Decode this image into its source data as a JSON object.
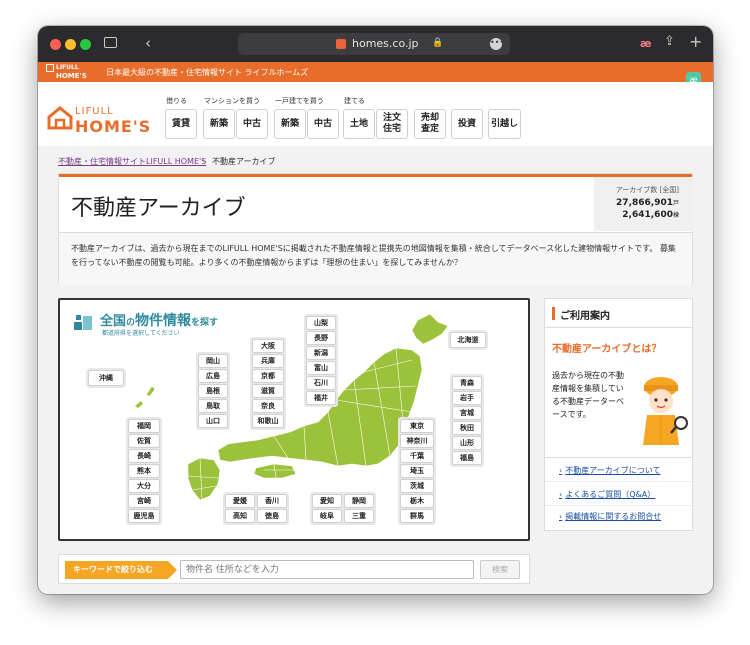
{
  "browser": {
    "url": "homes.co.jp"
  },
  "site_bar": {
    "logo_line1": "LIFULL",
    "logo_line2": "HOME'S",
    "tagline": "日本最大級の不動産・住宅情報サイト ライフルホームズ",
    "extension_badge": "æ"
  },
  "header": {
    "logo_top": "LIFULL",
    "logo_bottom": "HOME'S",
    "groups": [
      {
        "label": "借りる",
        "buttons": [
          "賃貸"
        ]
      },
      {
        "label": "マンションを買う",
        "buttons": [
          "新築",
          "中古"
        ]
      },
      {
        "label": "一戸建てを買う",
        "buttons": [
          "新築",
          "中古"
        ]
      },
      {
        "label": "建てる",
        "buttons": [
          "土地",
          "注文\n住宅"
        ]
      }
    ],
    "other_buttons": [
      "売却\n査定",
      "投資",
      "引越し"
    ]
  },
  "breadcrumb": {
    "link": "不動産・住宅情報サイトLIFULL HOME'S",
    "current": "不動産アーカイブ"
  },
  "page": {
    "title": "不動産アーカイブ",
    "count_label": "アーカイブ数 [全国]",
    "count_units": "27,866,901",
    "count_units_suffix": "戸",
    "count_buildings": "2,641,600",
    "count_buildings_suffix": "棟",
    "description": "不動産アーカイブは、過去から現在までのLIFULL HOME'Sに掲載された不動産情報と提携先の地図情報を集積・統合してデータベース化した建物情報サイトです。 募集を行ってない不動産の閲覧も可能。より多くの不動産情報からまずは「理想の住まい」を探してみませんか？"
  },
  "map": {
    "heading_prefix": "全国",
    "heading_mid": "の",
    "heading_main": "物件情報",
    "heading_suffix": "を探す",
    "subheading": "都道府県を選択してください",
    "okinawa": "沖縄",
    "hokkaido": "北海道",
    "kyushu": [
      "福岡",
      "佐賀",
      "長崎",
      "熊本",
      "大分",
      "宮崎",
      "鹿児島"
    ],
    "chugoku": [
      "岡山",
      "広島",
      "島根",
      "鳥取",
      "山口"
    ],
    "kinki": [
      "大阪",
      "兵庫",
      "京都",
      "滋賀",
      "奈良",
      "和歌山"
    ],
    "chubu_north": [
      "山梨",
      "長野",
      "新潟",
      "富山",
      "石川",
      "福井"
    ],
    "tohoku": [
      "青森",
      "岩手",
      "宮城",
      "秋田",
      "山形",
      "福島"
    ],
    "kanto": [
      "東京",
      "神奈川",
      "千葉",
      "埼玉",
      "茨城",
      "栃木",
      "群馬"
    ],
    "shikoku": [
      "愛媛",
      "香川",
      "高知",
      "徳島"
    ],
    "tokai": [
      "愛知",
      "静岡",
      "岐阜",
      "三重"
    ]
  },
  "sidebar": {
    "title": "ご利用案内",
    "question": "不動産アーカイブとは？",
    "body": "過去から現在の不動産情報を集積している不動産データーベースです。",
    "links": [
      "不動産アーカイブについて",
      "よくあるご質問（Q&A）",
      "掲載情報に関するお問合せ"
    ]
  },
  "search": {
    "label": "キーワードで絞り込む",
    "placeholder": "物件名 住所などを入力",
    "button": "検索"
  },
  "colors": {
    "brand_orange": "#e86d2a",
    "map_green": "#9bc23a",
    "title_teal": "#2f8a9e"
  }
}
